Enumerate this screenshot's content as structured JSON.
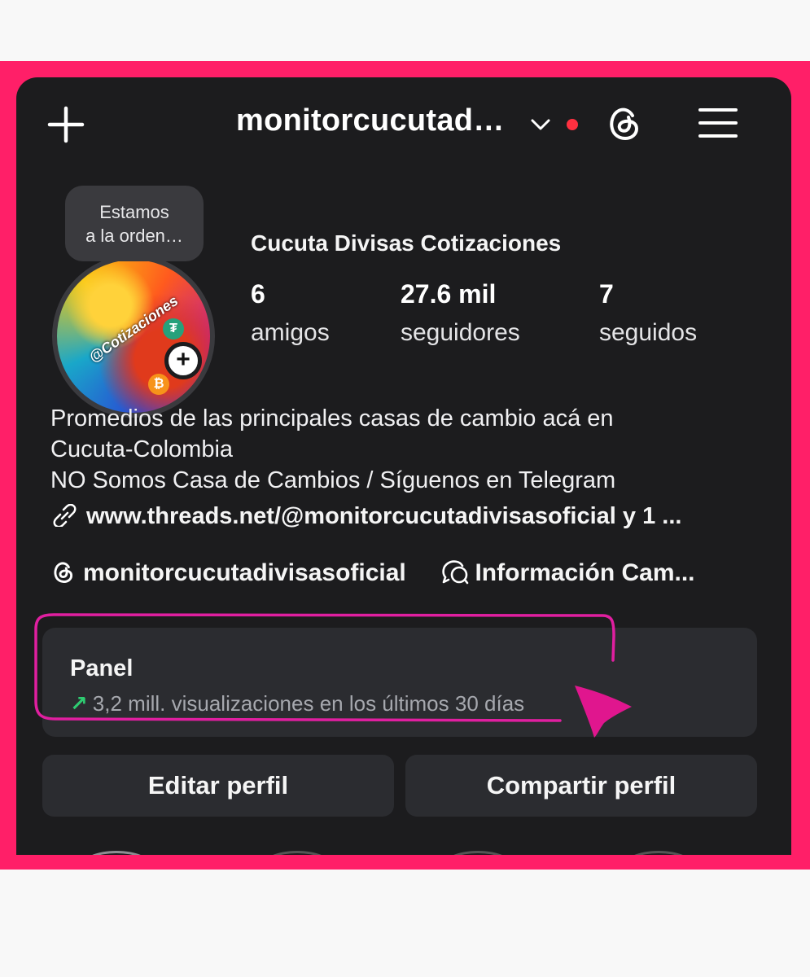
{
  "header": {
    "new_icon": "plus-icon",
    "username": "monitorcucutad…",
    "switch_icon": "chevron-down-icon",
    "notification_color": "#ff3040",
    "threads_icon": "threads-icon",
    "menu_icon": "hamburger-menu-icon"
  },
  "profile": {
    "note_line1": "Estamos",
    "note_line2": "a la orden…",
    "avatar_text": "@Cotizaciones",
    "add_story_symbol": "+",
    "display_name": "Cucuta Divisas Cotizaciones",
    "stats": [
      {
        "value": "6",
        "label": "amigos"
      },
      {
        "value": "27.6 mil",
        "label": "seguidores"
      },
      {
        "value": "7",
        "label": "seguidos"
      }
    ],
    "bio": [
      "Promedios de las principales casas de cambio acá en",
      "Cucuta-Colombia",
      "NO Somos Casa de Cambios / Síguenos en Telegram"
    ],
    "link": "www.threads.net/@monitorcucutadivisasoficial y 1 ...",
    "threads_handle": "monitorcucutadivisasoficial",
    "channel": "Información Cam..."
  },
  "panel": {
    "title": "Panel",
    "arrow": "↗",
    "subtitle": "3,2 mill. visualizaciones en los últimos 30 días"
  },
  "buttons": {
    "edit": "Editar perfil",
    "share": "Compartir perfil"
  },
  "colors": {
    "frame": "#ff1f68",
    "background": "#1c1c1e",
    "card": "#2b2c30",
    "highlight": "#e01fa0"
  }
}
